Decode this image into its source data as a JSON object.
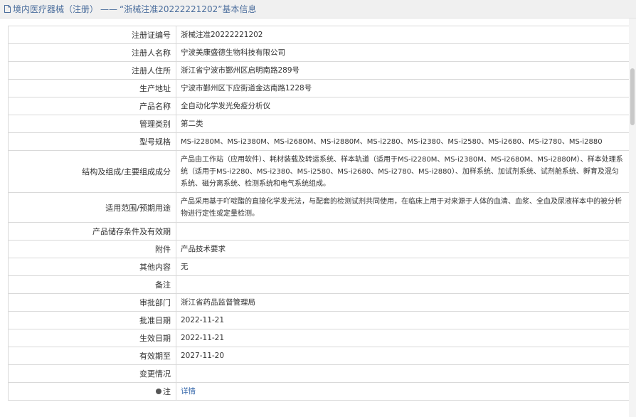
{
  "header": {
    "category": "境内医疗器械（注册）",
    "separator": "——",
    "title": "“浙械注准20222221202”基本信息"
  },
  "rows": [
    {
      "label": "注册证编号",
      "value": "浙械注准20222221202"
    },
    {
      "label": "注册人名称",
      "value": "宁波美康盛德生物科技有限公司"
    },
    {
      "label": "注册人住所",
      "value": "浙江省宁波市鄞州区启明南路289号"
    },
    {
      "label": "生产地址",
      "value": "宁波市鄞州区下应街道金达南路1228号"
    },
    {
      "label": "产品名称",
      "value": "全自动化学发光免疫分析仪"
    },
    {
      "label": "管理类别",
      "value": "第二类"
    },
    {
      "label": "型号规格",
      "value": "MS-i2280M、MS-i2380M、MS-i2680M、MS-i2880M、MS-i2280、MS-i2380、MS-i2580、MS-i2680、MS-i2780、MS-i2880"
    },
    {
      "label": "结构及组成/主要组成成分",
      "value": "产品由工作站（应用软件）、耗材装载及转运系统、样本轨道（适用于MS-i2280M、MS-i2380M、MS-i2680M、MS-i2880M）、样本处理系统（适用于MS-i2280、MS-i2380、MS-i2580、MS-i2680、MS-i2780、MS-i2880）、加样系统、加试剂系统、试剂舱系统、孵育及混匀系统、磁分离系统、检测系统和电气系统组成。"
    },
    {
      "label": "适用范围/预期用途",
      "value": "产品采用基于吖啶酯的直接化学发光法，与配套的检测试剂共同使用，在临床上用于对来源于人体的血清、血浆、全血及尿液样本中的被分析物进行定性或定量检测。"
    },
    {
      "label": "产品储存条件及有效期",
      "value": ""
    },
    {
      "label": "附件",
      "value": "产品技术要求"
    },
    {
      "label": "其他内容",
      "value": "无"
    },
    {
      "label": "备注",
      "value": ""
    },
    {
      "label": "审批部门",
      "value": "浙江省药品监督管理局"
    },
    {
      "label": "批准日期",
      "value": "2022-11-21"
    },
    {
      "label": "生效日期",
      "value": "2022-11-21"
    },
    {
      "label": "有效期至",
      "value": "2027-11-20"
    },
    {
      "label": "变更情况",
      "value": ""
    },
    {
      "label": "注",
      "value": "详情"
    }
  ],
  "icons": {
    "header": "document-icon",
    "note": "pin-icon"
  },
  "colors": {
    "header_text": "#4a6d9c",
    "link": "#3366aa",
    "border": "#d9d9d9"
  }
}
